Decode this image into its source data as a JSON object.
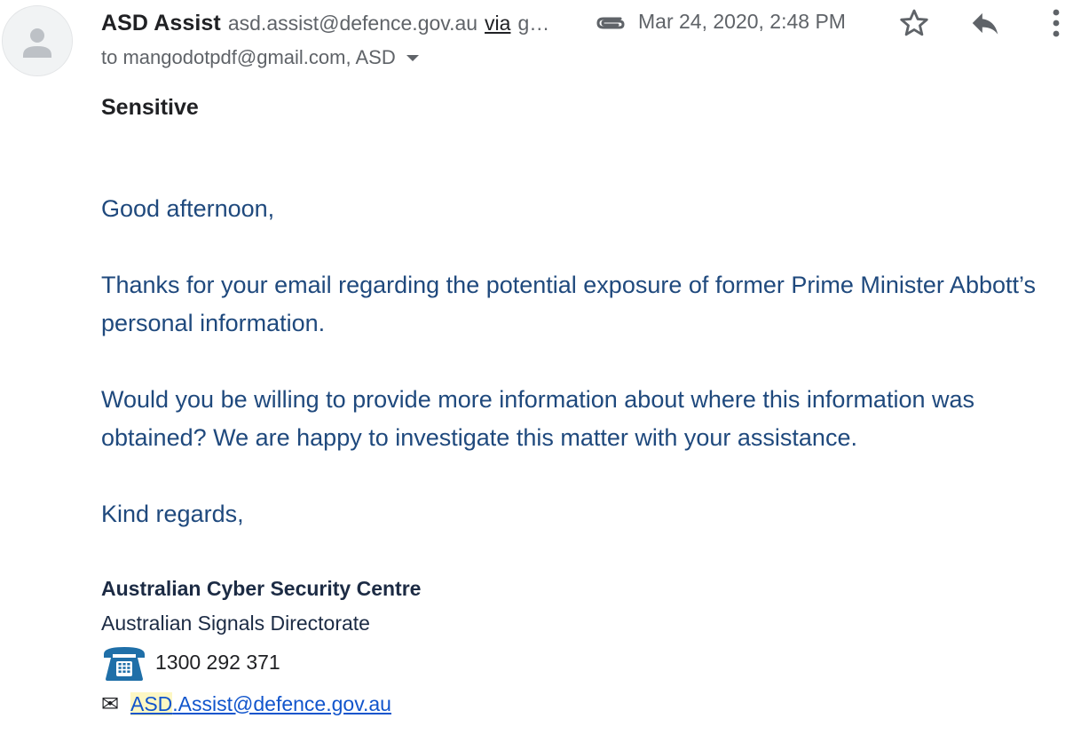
{
  "header": {
    "sender_name": "ASD Assist",
    "sender_email": "asd.assist@defence.gov.au",
    "via_label": "via",
    "via_rest": "g…",
    "date": "Mar 24, 2020, 2:48 PM",
    "recipients": "to mangodotpdf@gmail.com, ASD",
    "icons": {
      "avatar": "person-avatar-icon",
      "attachment": "paperclip-icon",
      "star": "star-icon",
      "reply": "reply-icon",
      "more": "more-vert-icon",
      "recipients_toggle": "caret-down-icon"
    }
  },
  "message": {
    "sensitivity": "Sensitive",
    "greeting": "Good afternoon,",
    "paragraph1": "Thanks for your email regarding the potential exposure of former Prime Minister Abbott’s personal information.",
    "paragraph2": "Would you be willing to provide more information about where this information was obtained? We are happy to investigate this matter with your assistance.",
    "closing": "Kind regards,"
  },
  "signature": {
    "organisation": "Australian Cyber Security Centre",
    "department": "Australian Signals Directorate",
    "phone_icon": "telephone-icon",
    "phone": "1300 292 371",
    "mail_icon": "✉",
    "email_highlight": "ASD",
    "email_rest": ".Assist@defence.gov.au"
  },
  "colors": {
    "body_text": "#1f497d",
    "signature_text": "#1c2b44",
    "meta_gray": "#5f6368",
    "link": "#1155cc",
    "highlight": "#fdf7c3"
  }
}
